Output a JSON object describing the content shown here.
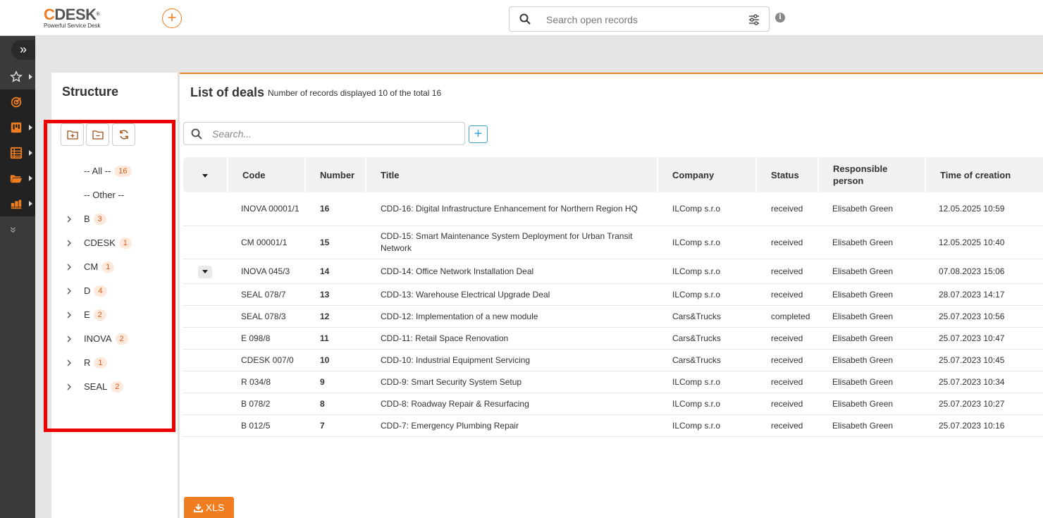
{
  "header": {
    "logo_text": "DESK",
    "logo_c": "C",
    "logo_reg": "®",
    "logo_tagline": "Powerful Service Desk",
    "add_symbol": "+",
    "search_placeholder": "Search open records",
    "info_symbol": "i"
  },
  "sidebar": {
    "expand_symbol": "»",
    "collapse_symbol": "«",
    "items": [
      {
        "icon": "star-icon"
      },
      {
        "icon": "target-icon"
      },
      {
        "icon": "kanban-icon"
      },
      {
        "icon": "list-icon"
      },
      {
        "icon": "folder-icon"
      },
      {
        "icon": "boxes-icon"
      }
    ]
  },
  "structure": {
    "title": "Structure",
    "tree": [
      {
        "label": "-- All --",
        "count": "16",
        "expandable": false
      },
      {
        "label": "-- Other --",
        "count": "",
        "expandable": false
      },
      {
        "label": "B",
        "count": "3",
        "expandable": true
      },
      {
        "label": "CDESK",
        "count": "1",
        "expandable": true
      },
      {
        "label": "CM",
        "count": "1",
        "expandable": true
      },
      {
        "label": "D",
        "count": "4",
        "expandable": true
      },
      {
        "label": "E",
        "count": "2",
        "expandable": true
      },
      {
        "label": "INOVA",
        "count": "2",
        "expandable": true
      },
      {
        "label": "R",
        "count": "1",
        "expandable": true
      },
      {
        "label": "SEAL",
        "count": "2",
        "expandable": true
      }
    ]
  },
  "list": {
    "title": "List of deals",
    "count_text": "Number of records displayed 10 of the total 16",
    "search_placeholder": "Search...",
    "add_symbol": "+",
    "columns": [
      "Code",
      "Number",
      "Title",
      "Company",
      "Status",
      "Responsible person",
      "Time of creation"
    ],
    "rows": [
      {
        "code": "INOVA 00001/1",
        "number": "16",
        "title": "CDD-16: Digital Infrastructure Enhancement for Northern Region HQ",
        "company": "ILComp s.r.o",
        "status": "received",
        "person": "Elisabeth Green",
        "time": "12.05.2025 10:59",
        "toggle": false
      },
      {
        "code": "CM 00001/1",
        "number": "15",
        "title": "CDD-15: Smart Maintenance System Deployment for Urban Transit Network",
        "company": "ILComp s.r.o",
        "status": "received",
        "person": "Elisabeth Green",
        "time": "12.05.2025 10:40",
        "toggle": false
      },
      {
        "code": "INOVA 045/3",
        "number": "14",
        "title": "CDD-14: Office Network Installation Deal",
        "company": "ILComp s.r.o",
        "status": "received",
        "person": "Elisabeth Green",
        "time": "07.08.2023 15:06",
        "toggle": true
      },
      {
        "code": "SEAL 078/7",
        "number": "13",
        "title": "CDD-13: Warehouse Electrical Upgrade Deal",
        "company": "ILComp s.r.o",
        "status": "received",
        "person": "Elisabeth Green",
        "time": "28.07.2023 14:17",
        "toggle": false
      },
      {
        "code": "SEAL 078/3",
        "number": "12",
        "title": "CDD-12: Implementation of a new module",
        "company": "Cars&Trucks",
        "status": "completed",
        "person": "Elisabeth Green",
        "time": "25.07.2023 10:56",
        "toggle": false
      },
      {
        "code": "E 098/8",
        "number": "11",
        "title": "CDD-11: Retail Space Renovation",
        "company": "Cars&Trucks",
        "status": "received",
        "person": "Elisabeth Green",
        "time": "25.07.2023 10:47",
        "toggle": false
      },
      {
        "code": "CDESK 007/0",
        "number": "10",
        "title": "CDD-10: Industrial Equipment Servicing",
        "company": "Cars&Trucks",
        "status": "received",
        "person": "Elisabeth Green",
        "time": "25.07.2023 10:45",
        "toggle": false
      },
      {
        "code": "R 034/8",
        "number": "9",
        "title": "CDD-9: Smart Security System Setup",
        "company": "ILComp s.r.o",
        "status": "received",
        "person": "Elisabeth Green",
        "time": "25.07.2023 10:34",
        "toggle": false
      },
      {
        "code": "B 078/2",
        "number": "8",
        "title": "CDD-8: Roadway Repair & Resurfacing",
        "company": "ILComp s.r.o",
        "status": "received",
        "person": "Elisabeth Green",
        "time": "25.07.2023 10:27",
        "toggle": false
      },
      {
        "code": "B 012/5",
        "number": "7",
        "title": "CDD-7: Emergency Plumbing Repair",
        "company": "ILComp s.r.o",
        "status": "received",
        "person": "Elisabeth Green",
        "time": "25.07.2023 10:16",
        "toggle": false
      }
    ],
    "export_label": "XLS"
  },
  "colors": {
    "accent": "#f07d1f",
    "highlight_box": "#ee0000",
    "add_button": "#3aa0d8"
  }
}
